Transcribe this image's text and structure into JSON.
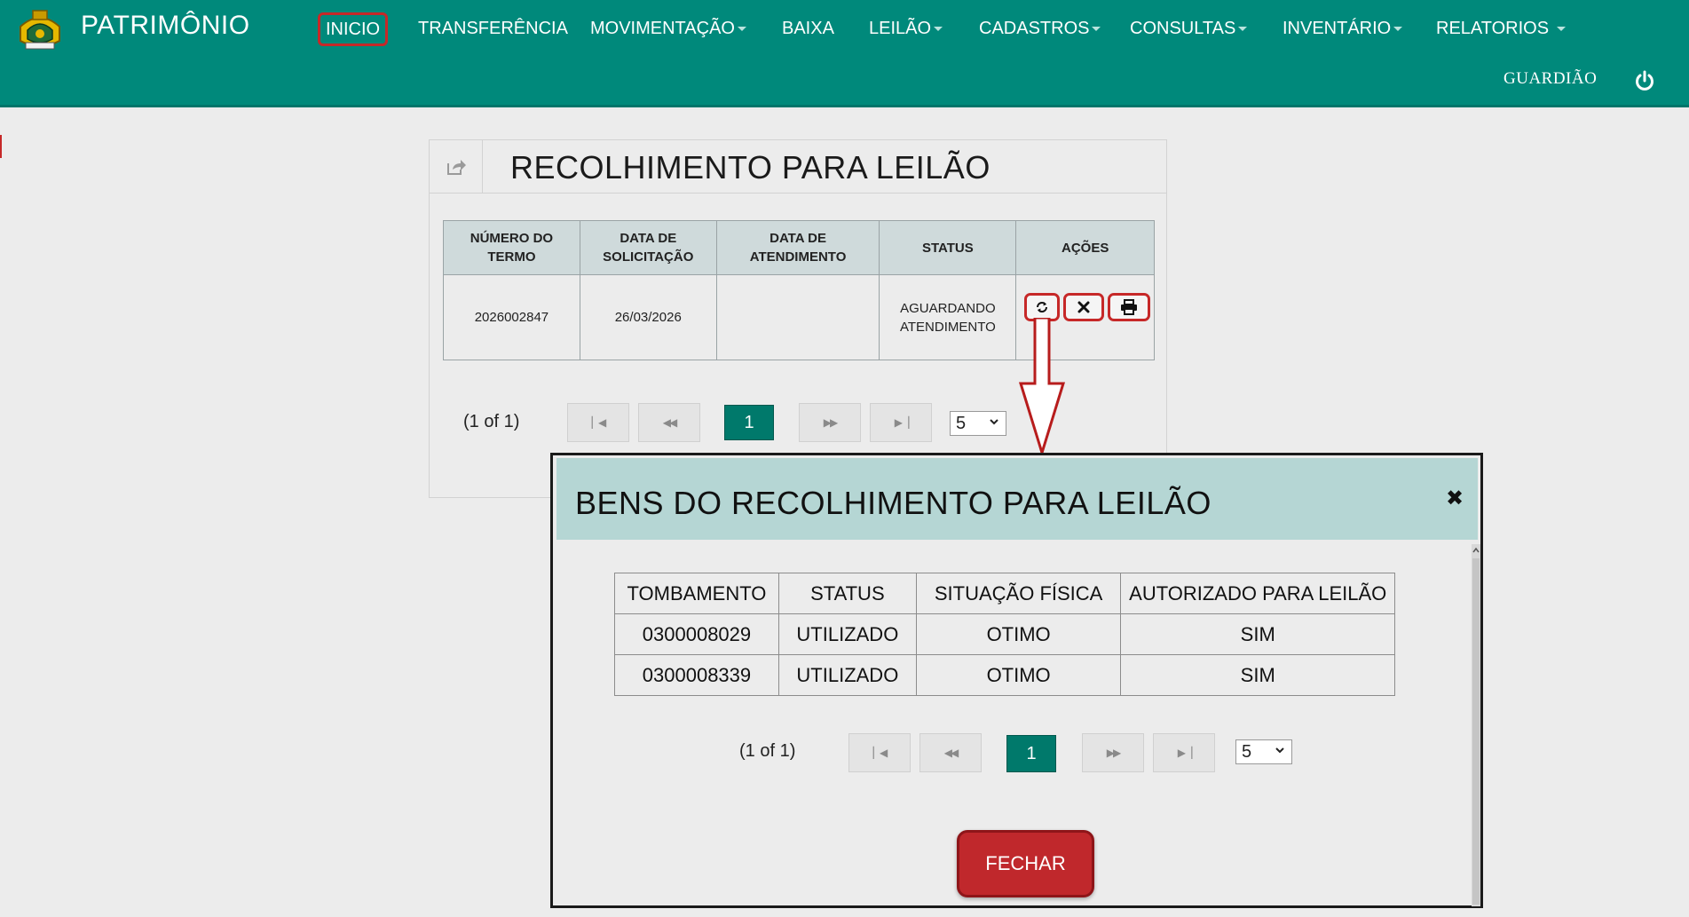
{
  "app": {
    "brand": "PATRIMÔNIO"
  },
  "nav": {
    "items": [
      {
        "label": "INICIO",
        "dropdown": false,
        "active": true
      },
      {
        "label": "TRANSFERÊNCIA",
        "dropdown": false
      },
      {
        "label": "MOVIMENTAÇÃO",
        "dropdown": true
      },
      {
        "label": "BAIXA",
        "dropdown": false
      },
      {
        "label": "LEILÃO",
        "dropdown": true
      },
      {
        "label": "CADASTROS",
        "dropdown": true
      },
      {
        "label": "CONSULTAS",
        "dropdown": true
      },
      {
        "label": "INVENTÁRIO",
        "dropdown": true
      },
      {
        "label": "RELATORIOS",
        "dropdown": true
      }
    ],
    "user": "GUARDIÃO",
    "logout_icon": "power-icon"
  },
  "panel": {
    "title": "RECOLHIMENTO PARA LEILÃO",
    "share_icon": "share-icon",
    "columns": [
      "NÚMERO DO TERMO",
      "DATA DE SOLICITAÇÃO",
      "DATA DE ATENDIMENTO",
      "STATUS",
      "AÇÕES"
    ],
    "rows": [
      {
        "numero": "2026002847",
        "data_solicitacao": "26/03/2026",
        "data_atendimento": "",
        "status": "AGUARDANDO ATENDIMENTO"
      }
    ],
    "actions": [
      "refresh-icon",
      "close-icon",
      "print-icon"
    ],
    "pager": {
      "info": "(1 of 1)",
      "page": "1",
      "per_page": "5"
    }
  },
  "modal": {
    "title": "BENS DO RECOLHIMENTO PARA LEILÃO",
    "close": "✖",
    "columns": [
      "TOMBAMENTO",
      "STATUS",
      "SITUAÇÃO FÍSICA",
      "AUTORIZADO PARA LEILÃO"
    ],
    "rows": [
      [
        "0300008029",
        "UTILIZADO",
        "OTIMO",
        "SIM"
      ],
      [
        "0300008339",
        "UTILIZADO",
        "OTIMO",
        "SIM"
      ]
    ],
    "pager": {
      "info": "(1 of 1)",
      "page": "1",
      "per_page": "5"
    },
    "close_button": "FECHAR"
  },
  "colors": {
    "nav": "#00897b",
    "accent": "#00796b",
    "highlight": "#c62828",
    "modal_header": "#b5d6d4"
  }
}
